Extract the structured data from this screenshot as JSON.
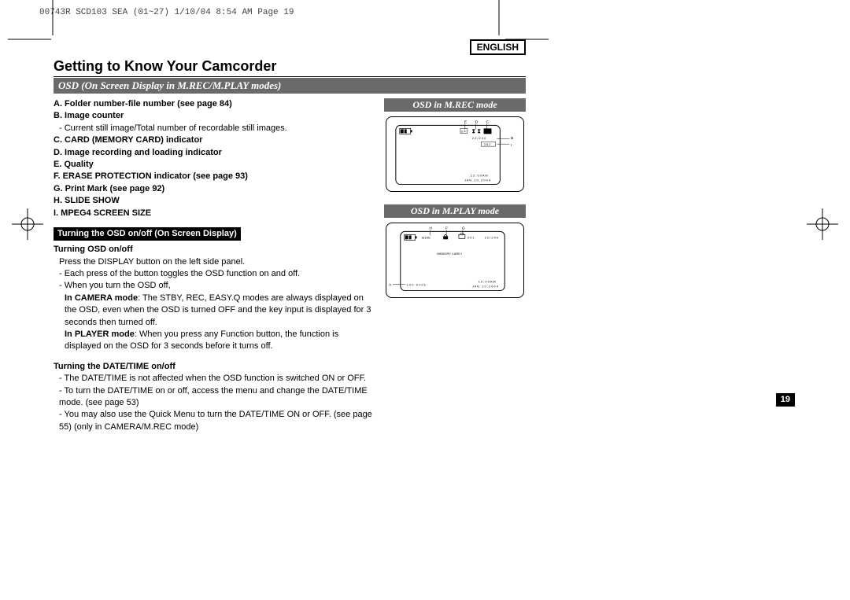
{
  "header": "00743R SCD103 SEA (01~27)  1/10/04 8:54 AM  Page 19",
  "language": "ENGLISH",
  "title": "Getting to Know Your Camcorder",
  "section_bar": "OSD (On Screen Display in M.REC/M.PLAY modes)",
  "list": {
    "A": "A. Folder number-file number (see page 84)",
    "B": "B. Image counter",
    "B_sub": "- Current still image/Total number of recordable still images.",
    "C": "C. CARD (MEMORY CARD) indicator",
    "D": "D. Image recording and loading indicator",
    "E": "E. Quality",
    "F": "F. ERASE PROTECTION indicator (see page 93)",
    "G": "G. Print Mark (see page 92)",
    "H": "H. SLIDE SHOW",
    "I": "I.  MPEG4 SCREEN SIZE"
  },
  "sub_bar": "Turning the OSD on/off (On Screen Display)",
  "t1": "Turning OSD on/off",
  "t1_lines": {
    "a": "Press the DISPLAY button on the left side panel.",
    "b": "- Each press of the button toggles the OSD function on and off.",
    "c": "- When you turn the OSD off,",
    "d1a": "In CAMERA mode",
    "d1b": ": The STBY, REC, EASY.Q modes are always displayed on the OSD, even when the OSD is turned OFF and the key input is displayed for 3 seconds then turned off.",
    "d2a": "In PLAYER mode",
    "d2b": ": When you press any Function button, the function is displayed on the OSD for 3 seconds before it turns off."
  },
  "t2": "Turning the DATE/TIME on/off",
  "t2_lines": {
    "a": "- The DATE/TIME is not affected when the OSD function is switched ON or OFF.",
    "b": "- To turn the DATE/TIME on or off, access the menu and change the DATE/TIME mode. (see page 53)",
    "c": "- You may also use the Quick Menu to turn the DATE/TIME ON or OFF. (see page 55) (only in CAMERA/M.REC mode)"
  },
  "fig1": {
    "title": "OSD in M.REC mode",
    "labels": {
      "E": "E",
      "D": "D",
      "C": "C",
      "B": "B",
      "I": "I"
    },
    "text": {
      "count": "2 2 / 2 4 0",
      "sf": "S F",
      "res": "3 5 2",
      "time": "1 2 : 0 0 A M",
      "date": "J A N . 1 0 , 2 0 0 4"
    }
  },
  "fig2": {
    "title": "OSD in M.PLAY mode",
    "labels": {
      "H": "H",
      "F": "F",
      "G": "G",
      "A": "A"
    },
    "text": {
      "slide": "SLIDE",
      "n": "0 0 1",
      "count": "2 2 / 2 4 0",
      "mem": "MEMORY CARD !",
      "file": "1 0 0 - 0 0 0 1",
      "time": "1 2 : 0 0 A M",
      "date": "J A N . 1 0 , 2 0 0 4"
    }
  },
  "page_number": "19"
}
